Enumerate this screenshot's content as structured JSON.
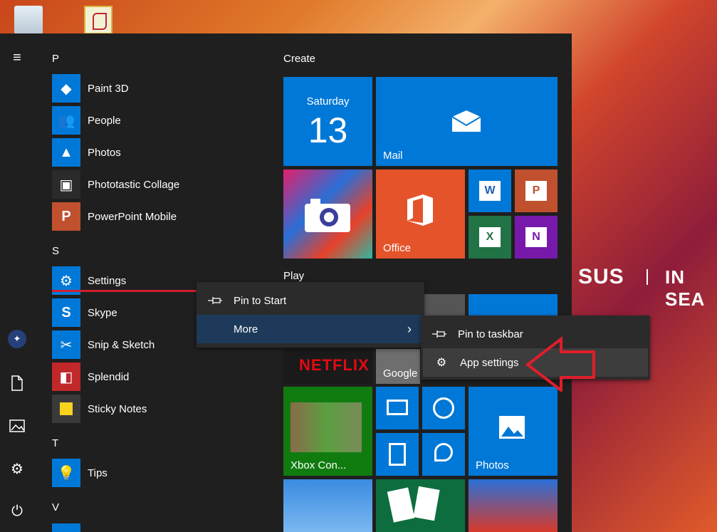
{
  "start": {
    "groups": {
      "letter_p": "P",
      "letter_s": "S",
      "letter_t": "T",
      "letter_v": "V"
    },
    "apps": [
      {
        "label": "Paint 3D",
        "color": "#0078d7"
      },
      {
        "label": "People",
        "color": "#0078d7"
      },
      {
        "label": "Photos",
        "color": "#0078d7"
      },
      {
        "label": "Phototastic Collage",
        "color": "#2b2b2b"
      },
      {
        "label": "PowerPoint Mobile",
        "color": "#c0502e"
      },
      {
        "label": "Settings",
        "color": "#0078d7"
      },
      {
        "label": "Skype",
        "color": "#0078d7"
      },
      {
        "label": "Snip & Sketch",
        "color": "#0078d7"
      },
      {
        "label": "Splendid",
        "color": "#c0282a"
      },
      {
        "label": "Sticky Notes",
        "color": "#3a3a3a"
      },
      {
        "label": "Tips",
        "color": "#0078d7"
      }
    ],
    "tile_groups": {
      "create": "Create",
      "play": "Play"
    },
    "tiles": {
      "calendar_day": "Saturday",
      "calendar_date": "13",
      "mail": "Mail",
      "office": "Office",
      "google": "Google",
      "xbox": "Xbox Con...",
      "photos": "Photos",
      "netflix": "NETFLIX"
    }
  },
  "context_menu": {
    "pin_to_start": "Pin to Start",
    "more": "More",
    "pin_to_taskbar": "Pin to taskbar",
    "app_settings": "App settings"
  },
  "wallpaper": {
    "brand": "SUS",
    "slogan": "IN SEA"
  }
}
